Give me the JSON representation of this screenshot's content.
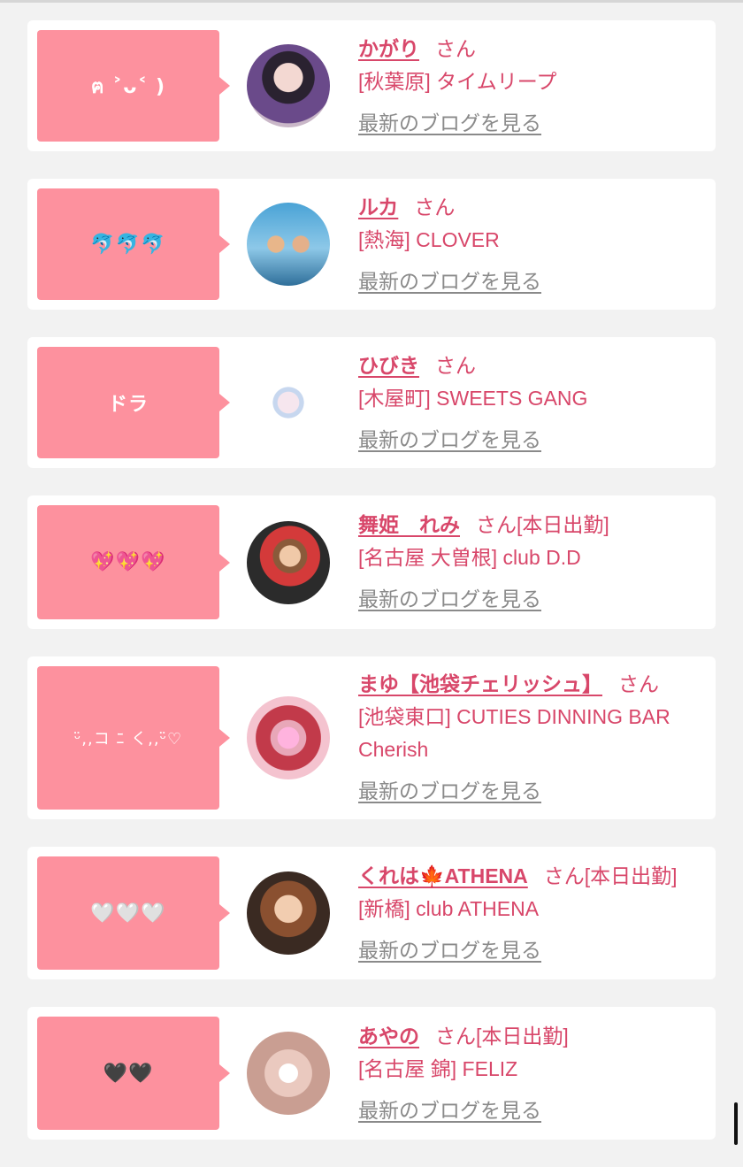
{
  "cards": [
    {
      "comment": "ฅ ˃ᴗ˂ )",
      "name": "かがり",
      "suffix": "さん",
      "status": "",
      "shop": "[秋葉原] タイムリープ",
      "blog_link": "最新のブログを見る"
    },
    {
      "comment": "🐬🐬🐬",
      "name": "ルカ",
      "suffix": "さん",
      "status": "",
      "shop": "[熱海] CLOVER",
      "blog_link": "最新のブログを見る"
    },
    {
      "comment": "ドラ",
      "name": "ひびき",
      "suffix": "さん",
      "status": "",
      "shop": "[木屋町] SWEETS GANG",
      "blog_link": "最新のブログを見る"
    },
    {
      "comment": "💖💖💖",
      "name": "舞姫　れみ",
      "suffix": "さん",
      "status": "[本日出勤]",
      "shop": "[名古屋 大曽根] club D.D",
      "blog_link": "最新のブログを見る"
    },
    {
      "comment": "ᵕ̈,,コ ﾆ く,,ᵕ̈♡",
      "name": "まゆ【池袋チェリッシュ】",
      "suffix": "さん",
      "status": "",
      "shop": "[池袋東口] CUTIES DINNING BAR Cherish",
      "blog_link": "最新のブログを見る"
    },
    {
      "comment": "🤍🤍🤍",
      "name": "くれは🍁ATHENA",
      "suffix": "さん",
      "status": "[本日出勤]",
      "shop": "[新橋] club ATHENA",
      "blog_link": "最新のブログを見る"
    },
    {
      "comment": "🖤🖤",
      "name": "あやの",
      "suffix": "さん",
      "status": "[本日出勤]",
      "shop": "[名古屋 錦] FELIZ",
      "blog_link": "最新のブログを見る"
    }
  ],
  "colors": {
    "accent": "#d8476a",
    "bubble": "#fd919e",
    "muted": "#8a8a8a",
    "background": "#f2f2f2"
  }
}
